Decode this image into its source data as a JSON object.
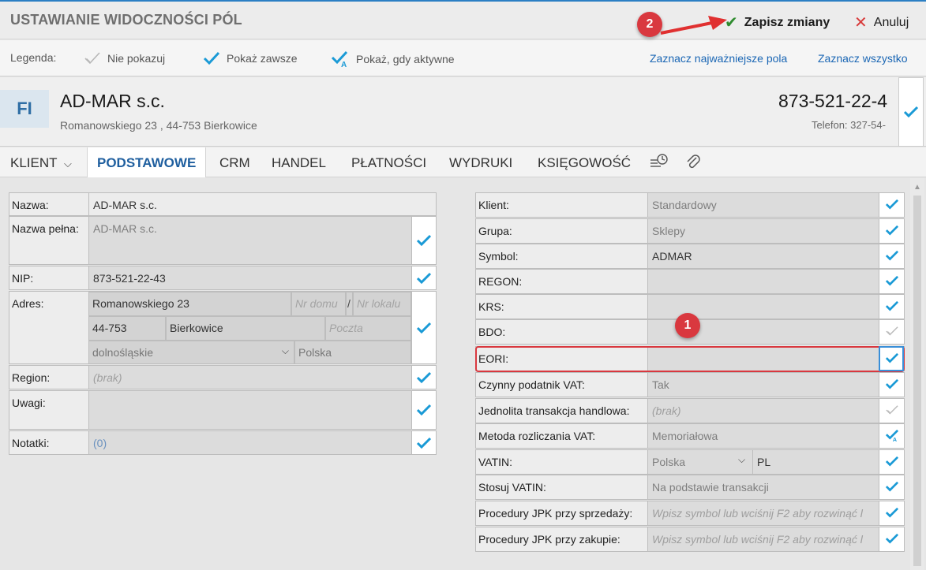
{
  "header": {
    "title": "USTAWIANIE WIDOCZNOŚCI PÓL",
    "save_label": "Zapisz zmiany",
    "cancel_label": "Anuluj"
  },
  "legend": {
    "label": "Legenda:",
    "hide": "Nie pokazuj",
    "always": "Pokaż zawsze",
    "when_active": "Pokaż, gdy aktywne",
    "mark_important": "Zaznacz najważniejsze pola",
    "mark_all": "Zaznacz wszystko"
  },
  "entity": {
    "badge": "FI",
    "name": "AD-MAR s.c.",
    "address": "Romanowskiego 23 , 44-753 Bierkowice",
    "nip": "873-521-22-4",
    "phone": "Telefon: 327-54-"
  },
  "tabs": {
    "client": "KLIENT",
    "basic": "PODSTAWOWE",
    "crm": "CRM",
    "trade": "HANDEL",
    "payments": "PŁATNOŚCI",
    "prints": "WYDRUKI",
    "accounting": "KSIĘGOWOŚĆ"
  },
  "left": {
    "nazwa": {
      "label": "Nazwa:",
      "value": "AD-MAR s.c."
    },
    "nazwa_pelna": {
      "label": "Nazwa pełna:",
      "value": "AD-MAR s.c."
    },
    "nip": {
      "label": "NIP:",
      "value": "873-521-22-43"
    },
    "adres": {
      "label": "Adres:",
      "street": "Romanowskiego 23",
      "house_ph": "Nr domu",
      "sep": "/",
      "flat_ph": "Nr lokalu",
      "zip": "44-753",
      "city": "Bierkowice",
      "post_ph": "Poczta",
      "region_sel": "dolnośląskie",
      "country": "Polska"
    },
    "region": {
      "label": "Region:",
      "value": "(brak)"
    },
    "uwagi": {
      "label": "Uwagi:",
      "value": ""
    },
    "notatki": {
      "label": "Notatki:",
      "value": "(0)"
    }
  },
  "right": [
    {
      "label": "Klient:",
      "value": "Standardowy",
      "state": "always"
    },
    {
      "label": "Grupa:",
      "value": "Sklepy",
      "state": "always"
    },
    {
      "label": "Symbol:",
      "value": "ADMAR",
      "state": "always"
    },
    {
      "label": "REGON:",
      "value": "",
      "state": "always"
    },
    {
      "label": "KRS:",
      "value": "",
      "state": "always"
    },
    {
      "label": "BDO:",
      "value": "",
      "state": "hide"
    },
    {
      "label": "EORI:",
      "value": "",
      "state": "always"
    },
    {
      "label": "Czynny podatnik VAT:",
      "value": "Tak",
      "state": "always"
    },
    {
      "label": "Jednolita transakcja handlowa:",
      "value": "(brak)",
      "state": "hide"
    },
    {
      "label": "Metoda rozliczania VAT:",
      "value": "Memoriałowa",
      "state": "active"
    },
    {
      "label": "VATIN:",
      "value": "Polska",
      "value2": "PL",
      "state": "always"
    },
    {
      "label": "Stosuj VATIN:",
      "value": "Na podstawie transakcji",
      "state": "always"
    },
    {
      "label": "Procedury JPK przy sprzedaży:",
      "value": "Wpisz symbol lub wciśnij F2 aby rozwinąć l",
      "state": "always"
    },
    {
      "label": "Procedury JPK przy zakupie:",
      "value": "Wpisz symbol lub wciśnij F2 aby rozwinąć l",
      "state": "always"
    }
  ],
  "markers": {
    "one": "1",
    "two": "2"
  },
  "colors": {
    "accent": "#1a9ad6",
    "highlight": "#d9383f",
    "save": "#2e8b2e"
  }
}
